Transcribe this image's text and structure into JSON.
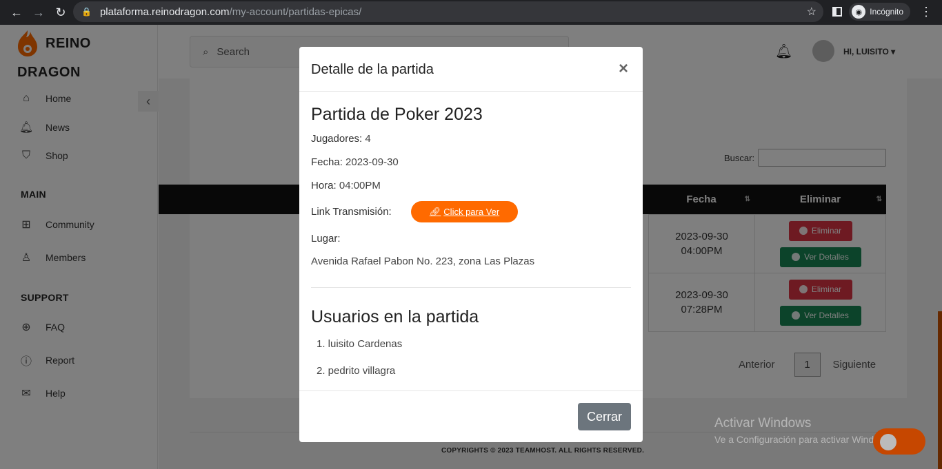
{
  "browser": {
    "url_host": "plataforma.reinodragon.com",
    "url_path": "/my-account/partidas-epicas/",
    "profile_label": "Incógnito"
  },
  "brand": {
    "line1": "REINO",
    "line2": "DRAGON",
    "accent": "#ff6a00"
  },
  "sidebar": {
    "items": [
      {
        "label": "Home",
        "icon": "home-icon"
      },
      {
        "label": "News",
        "icon": "bell-icon"
      },
      {
        "label": "Shop",
        "icon": "shopping-bag-icon"
      }
    ],
    "main_title": "MAIN",
    "main_items": [
      {
        "label": "Community",
        "icon": "community-icon"
      },
      {
        "label": "Members",
        "icon": "members-icon"
      }
    ],
    "support_title": "SUPPORT",
    "support_items": [
      {
        "label": "FAQ",
        "icon": "lifebuoy-icon"
      },
      {
        "label": "Report",
        "icon": "alert-icon"
      },
      {
        "label": "Help",
        "icon": "envelope-icon"
      }
    ]
  },
  "header": {
    "search_placeholder": "Search",
    "user_greeting": "HI, LUISITO"
  },
  "table": {
    "search_label": "Buscar:",
    "columns": [
      "Fecha",
      "Eliminar"
    ],
    "rows": [
      {
        "date": "2023-09-30",
        "time": "04:00PM",
        "delete": "Eliminar",
        "details": "Ver Detalles"
      },
      {
        "date": "2023-09-30",
        "time": "07:28PM",
        "delete": "Eliminar",
        "details": "Ver Detalles"
      }
    ],
    "pager": {
      "prev": "Anterior",
      "page": "1",
      "next": "Siguiente"
    }
  },
  "footer": {
    "copyright": "COPYRIGHTS © 2023 TEAMHOST. ALL RIGHTS RESERVED."
  },
  "modal": {
    "title": "Detalle de la partida",
    "close_symbol": "×",
    "game_title": "Partida de Poker 2023",
    "players_label": "Jugadores:",
    "players_value": "4",
    "date_label": "Fecha:",
    "date_value": "2023-09-30",
    "time_label": "Hora:",
    "time_value": "04:00PM",
    "link_label": "Link Transmisión:",
    "link_button": "Click para Ver",
    "place_label": "Lugar:",
    "address": "Avenida Rafael Pabon No. 223, zona Las Plazas",
    "users_title": "Usuarios en la partida",
    "users": [
      "1. luisito Cardenas",
      "2. pedrito villagra"
    ],
    "close_button": "Cerrar"
  },
  "watermark": {
    "line1": "Activar Windows",
    "line2": "Ve a Configuración para activar Windows."
  }
}
